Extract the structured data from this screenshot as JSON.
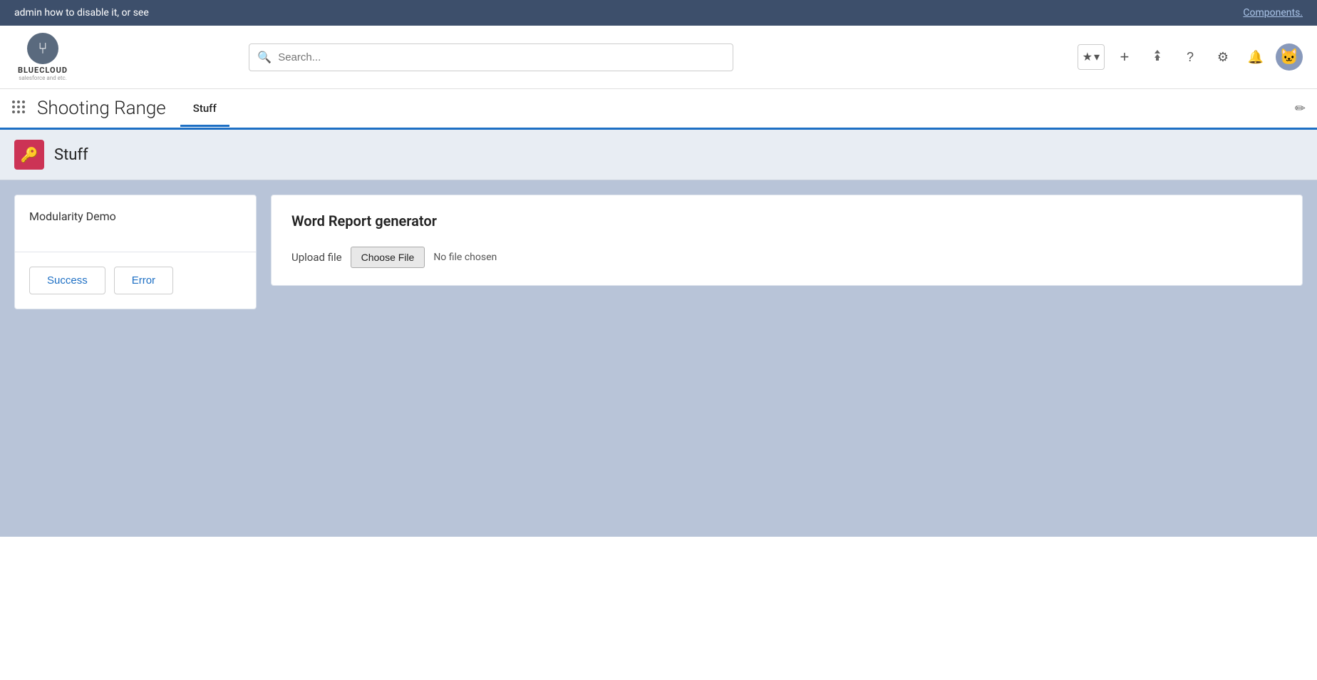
{
  "topBanner": {
    "text": "admin how to disable it, or see",
    "linkText": "Components."
  },
  "header": {
    "logoSymbol": "⑂",
    "logoName": "BLUECLOUD",
    "logoSubtext": "salesforce and etc.",
    "searchPlaceholder": "Search...",
    "icons": {
      "starred": "★",
      "starredDropdown": "▾",
      "add": "+",
      "tree": "△",
      "help": "?",
      "settings": "⚙",
      "notifications": "🔔"
    }
  },
  "nav": {
    "appTitle": "Shooting Range",
    "tabs": [
      {
        "label": "Stuff",
        "active": true
      }
    ]
  },
  "subHeader": {
    "iconSymbol": "🔑",
    "title": "Stuff"
  },
  "leftCard": {
    "topTitle": "Modularity Demo",
    "buttons": [
      {
        "label": "Success",
        "key": "success"
      },
      {
        "label": "Error",
        "key": "error"
      }
    ]
  },
  "rightCard": {
    "title": "Word Report generator",
    "uploadLabel": "Upload file",
    "chooseFileLabel": "Choose File",
    "noFileText": "No file chosen"
  }
}
